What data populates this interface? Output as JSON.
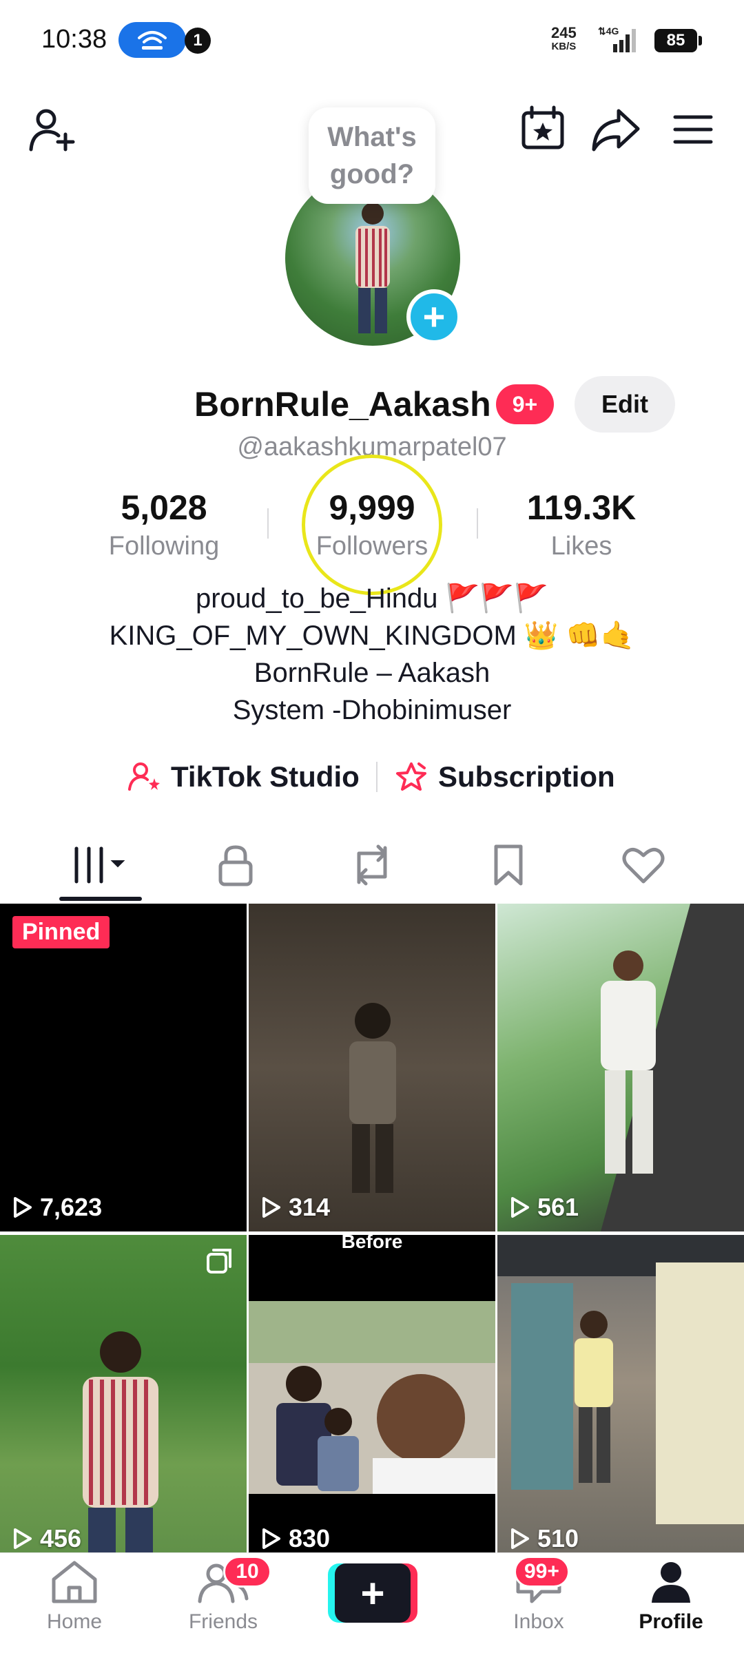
{
  "status_bar": {
    "time": "10:38",
    "notification_count": "1",
    "net_speed": "245",
    "net_unit": "KB/S",
    "network": "4G",
    "battery": "85"
  },
  "profile": {
    "bubble_text": "What's good?",
    "username": "BornRule_Aakash",
    "badge": "9+",
    "edit_label": "Edit",
    "handle": "@aakashkumarpatel07",
    "stats": {
      "following_count": "5,028",
      "following_label": "Following",
      "followers_count": "9,999",
      "followers_label": "Followers",
      "likes_count": "119.3K",
      "likes_label": "Likes"
    },
    "bio": [
      "proud_to_be_Hindu 🚩🚩🚩",
      "KING_OF_MY_OWN_KINGDOM 👑 👊🤙",
      "BornRule – Aakash",
      "System -Dhobinimuser"
    ],
    "links": {
      "studio": "TikTok Studio",
      "subscription": "Subscription"
    }
  },
  "grid": {
    "pinned_label": "Pinned",
    "before_label": "Before",
    "tiles": [
      {
        "views": "7,623"
      },
      {
        "views": "314"
      },
      {
        "views": "561"
      },
      {
        "views": "456"
      },
      {
        "views": "830"
      },
      {
        "views": "510"
      }
    ]
  },
  "bottom_nav": {
    "home": "Home",
    "friends": "Friends",
    "friends_badge": "10",
    "inbox": "Inbox",
    "inbox_badge": "99+",
    "profile": "Profile"
  },
  "colors": {
    "brand_red": "#fe2c55",
    "brand_cyan": "#25f4ee",
    "text_dark": "#161823",
    "text_muted": "#8a8b91"
  }
}
